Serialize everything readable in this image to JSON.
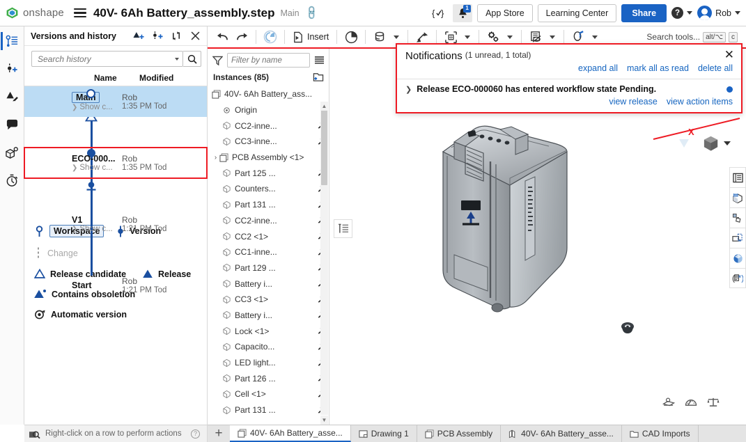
{
  "topbar": {
    "brand": "onshape",
    "doc_title": "40V- 6Ah Battery_assembly.step",
    "branch": "Main",
    "app_store": "App Store",
    "learning_center": "Learning Center",
    "share": "Share",
    "user": "Rob",
    "bell_badge": "1"
  },
  "versions_panel": {
    "title": "Versions and history",
    "search_placeholder": "Search history",
    "columns": {
      "name": "Name",
      "modified": "Modified"
    },
    "rows": [
      {
        "name": "Main",
        "user": "Rob",
        "show": "Show c...",
        "time": "1:35 PM Tod",
        "node": "workspace",
        "selected": true,
        "highlight": false,
        "boxed_name": true
      },
      {
        "name": "ECO-000...",
        "user": "Rob",
        "show": "Show c...",
        "time": "1:35 PM Tod",
        "node": "release-candidate",
        "selected": false,
        "highlight": true,
        "boxed_name": false
      },
      {
        "name": "V1",
        "user": "Rob",
        "show": "Show c...",
        "time": "1:21 PM Tod",
        "node": "version",
        "selected": false,
        "highlight": false,
        "boxed_name": false
      },
      {
        "name": "Start",
        "user": "Rob",
        "show": "",
        "time": "1:21 PM Tod",
        "node": "start",
        "selected": false,
        "highlight": false,
        "boxed_name": false
      }
    ],
    "legend": {
      "workspace": "Workspace",
      "version": "Version",
      "change": "Change",
      "release_candidate": "Release candidate",
      "release": "Release",
      "contains_obsoletion": "Contains obsoletion",
      "automatic_version": "Automatic version"
    },
    "status_text": "Right-click on a row to perform actions"
  },
  "instances_panel": {
    "filter_placeholder": "Filter by name",
    "count_label": "Instances (85)",
    "items": [
      {
        "label": "40V- 6Ah Battery_ass...",
        "icon": "assembly-icon",
        "indent": 0,
        "caret": "",
        "mate": false
      },
      {
        "label": "Origin",
        "icon": "origin-icon",
        "indent": 1,
        "caret": "",
        "mate": false
      },
      {
        "label": "CC2-inne...",
        "icon": "part-icon",
        "indent": 1,
        "caret": "",
        "mate": true
      },
      {
        "label": "CC3-inne...",
        "icon": "part-icon",
        "indent": 1,
        "caret": "",
        "mate": true
      },
      {
        "label": "PCB Assembly <1>",
        "icon": "assembly-icon",
        "indent": 1,
        "caret": "›",
        "mate": false
      },
      {
        "label": "Part 125 ...",
        "icon": "part-icon",
        "indent": 1,
        "caret": "",
        "mate": true
      },
      {
        "label": "Counters...",
        "icon": "part-icon",
        "indent": 1,
        "caret": "",
        "mate": true
      },
      {
        "label": "Part 131 ...",
        "icon": "part-icon",
        "indent": 1,
        "caret": "",
        "mate": true
      },
      {
        "label": "CC2-inne...",
        "icon": "part-icon",
        "indent": 1,
        "caret": "",
        "mate": true
      },
      {
        "label": "CC2 <1>",
        "icon": "part-icon",
        "indent": 1,
        "caret": "",
        "mate": true
      },
      {
        "label": "CC1-inne...",
        "icon": "part-icon",
        "indent": 1,
        "caret": "",
        "mate": true
      },
      {
        "label": "Part 129 ...",
        "icon": "part-icon",
        "indent": 1,
        "caret": "",
        "mate": true
      },
      {
        "label": "Battery i...",
        "icon": "part-icon",
        "indent": 1,
        "caret": "",
        "mate": true
      },
      {
        "label": "CC3 <1>",
        "icon": "part-icon",
        "indent": 1,
        "caret": "",
        "mate": true
      },
      {
        "label": "Battery i...",
        "icon": "part-icon",
        "indent": 1,
        "caret": "",
        "mate": true
      },
      {
        "label": "Lock <1>",
        "icon": "part-icon",
        "indent": 1,
        "caret": "",
        "mate": true
      },
      {
        "label": "Capacito...",
        "icon": "part-icon",
        "indent": 1,
        "caret": "",
        "mate": true
      },
      {
        "label": "LED light...",
        "icon": "part-icon",
        "indent": 1,
        "caret": "",
        "mate": true
      },
      {
        "label": "Part 126 ...",
        "icon": "part-icon",
        "indent": 1,
        "caret": "",
        "mate": true
      },
      {
        "label": "Cell <1>",
        "icon": "part-icon",
        "indent": 1,
        "caret": "",
        "mate": true
      },
      {
        "label": "Part 131 ...",
        "icon": "part-icon",
        "indent": 1,
        "caret": "",
        "mate": true
      }
    ]
  },
  "toolbar": {
    "insert_label": "Insert",
    "search_label": "Search tools...",
    "kbd1": "alt/⌥",
    "kbd2": "c"
  },
  "notifications": {
    "title": "Notifications",
    "count": "(1 unread, 1 total)",
    "expand_all": "expand all",
    "mark_all_read": "mark all as read",
    "delete_all": "delete all",
    "message_prefix": "Release ",
    "message_id": "ECO-000060",
    "message_mid": " has entered workflow state ",
    "message_state": "Pending.",
    "view_release": "view release",
    "view_action_items": "view action items"
  },
  "tabs": [
    {
      "label": "40V- 6Ah Battery_asse...",
      "icon": "assembly-icon",
      "active": true
    },
    {
      "label": "Drawing 1",
      "icon": "drawing-icon",
      "active": false
    },
    {
      "label": "PCB Assembly",
      "icon": "assembly-icon",
      "active": false
    },
    {
      "label": "40V- 6Ah Battery_asse...",
      "icon": "part-studio-icon",
      "active": false
    },
    {
      "label": "CAD Imports",
      "icon": "folder-icon",
      "active": false
    }
  ],
  "colors": {
    "accent": "#1a63c4",
    "highlight": "#ee1b24",
    "selection": "#bcdcf4",
    "graph": "#1a4fa0"
  }
}
